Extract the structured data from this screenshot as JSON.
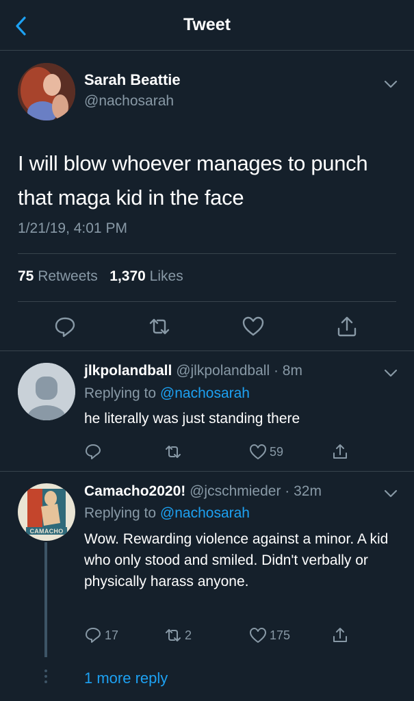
{
  "header": {
    "title": "Tweet"
  },
  "main_tweet": {
    "name": "Sarah Beattie",
    "handle": "@nachosarah",
    "text": "I will blow whoever manages to punch that maga kid in the face",
    "timestamp": "1/21/19, 4:01 PM",
    "retweets_count": "75",
    "retweets_label": "Retweets",
    "likes_count": "1,370",
    "likes_label": "Likes"
  },
  "replies": [
    {
      "name": "jlkpolandball",
      "handle": "@jlkpolandball",
      "time": "· 8m",
      "replying_label": "Replying to",
      "replying_to": "@nachosarah",
      "text": "he literally was just standing there",
      "reply_count": "",
      "retweet_count": "",
      "like_count": "59"
    },
    {
      "name": "Camacho2020!",
      "handle": "@jcschmieder",
      "time": "· 32m",
      "replying_label": "Replying to",
      "replying_to": "@nachosarah",
      "text": "Wow. Rewarding violence against a minor. A kid who only stood and smiled. Didn't verbally or physically harass anyone.",
      "avatar_text": "CAMACHO",
      "reply_count": "17",
      "retweet_count": "2",
      "like_count": "175"
    }
  ],
  "more_replies_label": "1 more reply",
  "colors": {
    "background": "#15202b",
    "accent": "#1da1f2",
    "muted": "#8899a6",
    "divider": "#38444d"
  }
}
